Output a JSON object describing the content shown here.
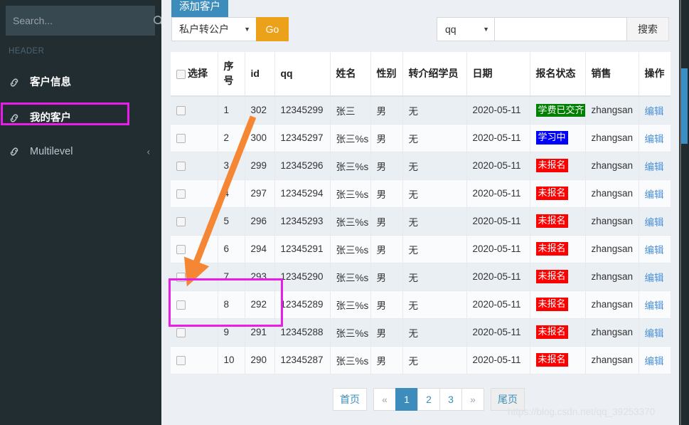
{
  "sidebar": {
    "search": {
      "placeholder": "Search...",
      "value": "",
      "icon": "search-icon"
    },
    "header_label": "HEADER",
    "items": [
      {
        "label": "客户信息",
        "icon": "link-icon",
        "active": false
      },
      {
        "label": "我的客户",
        "icon": "link-icon",
        "active": true
      },
      {
        "label": "Multilevel",
        "icon": "link-icon",
        "active": false,
        "chevron": "‹"
      }
    ]
  },
  "toolbar": {
    "add_label": "添加客户",
    "transfer_select": {
      "value": "私户转公户",
      "caret": "▼"
    },
    "go_label": "Go",
    "field_select": {
      "value": "qq",
      "caret": "▼"
    },
    "keyword_input": {
      "value": "",
      "placeholder": ""
    },
    "search_label": "搜索"
  },
  "table": {
    "columns": [
      "选择",
      "序号",
      "id",
      "qq",
      "姓名",
      "性别",
      "转介绍学员",
      "日期",
      "报名状态",
      "销售",
      "操作"
    ],
    "action_label": "编辑",
    "rows": [
      {
        "no": "1",
        "id": "302",
        "qq": "12345299",
        "name": "张三",
        "sex": "男",
        "ref": "无",
        "date": "2020-05-11",
        "status": "学费已交齐",
        "status_color": "green",
        "sale": "zhangsan"
      },
      {
        "no": "2",
        "id": "300",
        "qq": "12345297",
        "name": "张三%s",
        "sex": "男",
        "ref": "无",
        "date": "2020-05-11",
        "status": "学习中",
        "status_color": "blue",
        "sale": "zhangsan"
      },
      {
        "no": "3",
        "id": "299",
        "qq": "12345296",
        "name": "张三%s",
        "sex": "男",
        "ref": "无",
        "date": "2020-05-11",
        "status": "未报名",
        "status_color": "red",
        "sale": "zhangsan"
      },
      {
        "no": "4",
        "id": "297",
        "qq": "12345294",
        "name": "张三%s",
        "sex": "男",
        "ref": "无",
        "date": "2020-05-11",
        "status": "未报名",
        "status_color": "red",
        "sale": "zhangsan"
      },
      {
        "no": "5",
        "id": "296",
        "qq": "12345293",
        "name": "张三%s",
        "sex": "男",
        "ref": "无",
        "date": "2020-05-11",
        "status": "未报名",
        "status_color": "red",
        "sale": "zhangsan"
      },
      {
        "no": "6",
        "id": "294",
        "qq": "12345291",
        "name": "张三%s",
        "sex": "男",
        "ref": "无",
        "date": "2020-05-11",
        "status": "未报名",
        "status_color": "red",
        "sale": "zhangsan"
      },
      {
        "no": "7",
        "id": "293",
        "qq": "12345290",
        "name": "张三%s",
        "sex": "男",
        "ref": "无",
        "date": "2020-05-11",
        "status": "未报名",
        "status_color": "red",
        "sale": "zhangsan"
      },
      {
        "no": "8",
        "id": "292",
        "qq": "12345289",
        "name": "张三%s",
        "sex": "男",
        "ref": "无",
        "date": "2020-05-11",
        "status": "未报名",
        "status_color": "red",
        "sale": "zhangsan"
      },
      {
        "no": "9",
        "id": "291",
        "qq": "12345288",
        "name": "张三%s",
        "sex": "男",
        "ref": "无",
        "date": "2020-05-11",
        "status": "未报名",
        "status_color": "red",
        "sale": "zhangsan"
      },
      {
        "no": "10",
        "id": "290",
        "qq": "12345287",
        "name": "张三%s",
        "sex": "男",
        "ref": "无",
        "date": "2020-05-11",
        "status": "未报名",
        "status_color": "red",
        "sale": "zhangsan"
      }
    ]
  },
  "pagination": {
    "first_label": "首页",
    "prev_label": "«",
    "pages": [
      "1",
      "2",
      "3"
    ],
    "active_page": "1",
    "next_label": "»",
    "last_label": "尾页"
  },
  "annotations": {
    "watermark": "https://blog.csdn.net/qq_39253370",
    "highlight_color": "#e81ee8",
    "arrow_color": "#f58634"
  },
  "colors": {
    "sidebar_bg": "#222d32",
    "accent_blue": "#3c8dbc",
    "go_orange": "#eca11b",
    "status_green": "#008000",
    "status_blue": "#0000ff",
    "status_red": "#ff0000",
    "page_bg": "#ecf0f5"
  }
}
